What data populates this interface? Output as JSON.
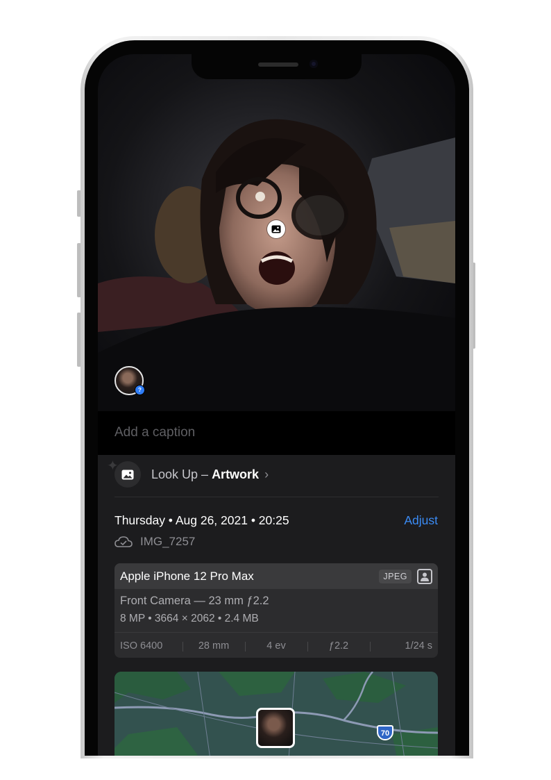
{
  "photo": {
    "caption_placeholder": "Add a caption",
    "lookup_icon": "photo-icon"
  },
  "lookup": {
    "prefix": "Look Up – ",
    "subject": "Artwork",
    "chevron": "›"
  },
  "info": {
    "date": "Thursday • Aug 26, 2021 • 20:25",
    "adjust_label": "Adjust",
    "file_name": "IMG_7257",
    "cloud_icon": "cloud-check-icon"
  },
  "camera_card": {
    "device": "Apple iPhone 12 Pro Max",
    "format": "JPEG",
    "lens": "Front Camera — 23 mm ƒ2.2",
    "specs": "8 MP  •  3664 × 2062  •  2.4 MB",
    "exif": [
      "ISO 6400",
      "28 mm",
      "4 ev",
      "ƒ2.2",
      "1/24 s"
    ]
  },
  "map": {
    "highway_label": "70"
  },
  "colors": {
    "accent": "#3b8cf6",
    "panel": "#1c1c1e",
    "card": "#2c2c2e",
    "map_land": "#2f4f4c"
  }
}
